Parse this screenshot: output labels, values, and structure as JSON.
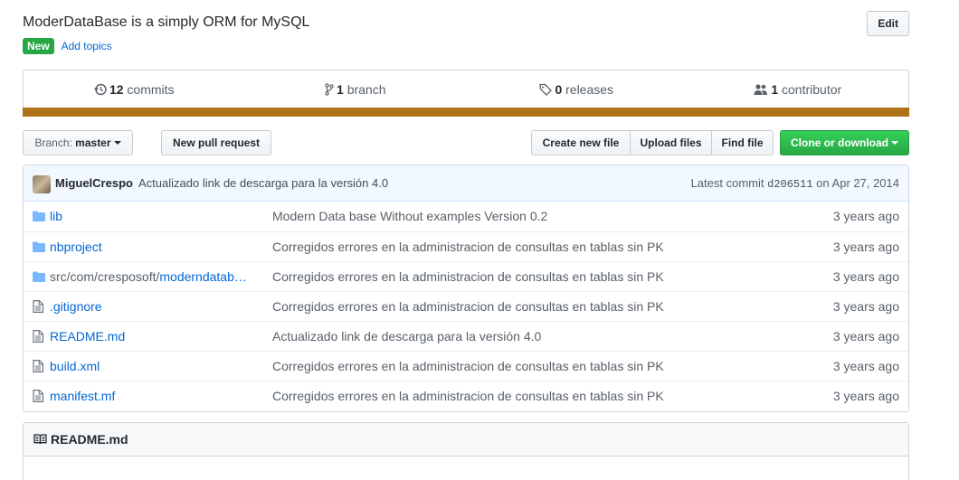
{
  "repo": {
    "description": "ModerDataBase is a simply ORM for MySQL",
    "edit_label": "Edit",
    "new_badge": "New",
    "add_topics": "Add topics"
  },
  "summary": {
    "commits_count": "12",
    "commits_label": "commits",
    "branches_count": "1",
    "branches_label": "branch",
    "releases_count": "0",
    "releases_label": "releases",
    "contributors_count": "1",
    "contributors_label": "contributor",
    "language_color": "#b07219"
  },
  "toolbar": {
    "branch_prefix": "Branch:",
    "branch_name": "master",
    "new_pull_request": "New pull request",
    "create_new_file": "Create new file",
    "upload_files": "Upload files",
    "find_file": "Find file",
    "clone_or_download": "Clone or download"
  },
  "commit": {
    "author": "MiguelCrespo",
    "message": "Actualizado link de descarga para la versión 4.0",
    "latest_label": "Latest commit",
    "sha": "d206511",
    "date_prefix": "on",
    "date": "Apr 27, 2014"
  },
  "files": [
    {
      "type": "dir",
      "icon": "folder-icon",
      "name": "lib",
      "message": "Modern Data base Without examples Version 0.2",
      "age": "3 years ago"
    },
    {
      "type": "dir",
      "icon": "folder-icon",
      "name": "nbproject",
      "message": "Corregidos errores en la administracion de consultas en tablas sin PK",
      "age": "3 years ago"
    },
    {
      "type": "dir",
      "icon": "folder-icon",
      "name_prefix": "src/com/cresposoft/",
      "name": "moderndatab…",
      "message": "Corregidos errores en la administracion de consultas en tablas sin PK",
      "age": "3 years ago"
    },
    {
      "type": "file",
      "icon": "file-icon",
      "name": ".gitignore",
      "message": "Corregidos errores en la administracion de consultas en tablas sin PK",
      "age": "3 years ago"
    },
    {
      "type": "file",
      "icon": "file-icon",
      "name": "README.md",
      "message": "Actualizado link de descarga para la versión 4.0",
      "age": "3 years ago"
    },
    {
      "type": "file",
      "icon": "file-icon",
      "name": "build.xml",
      "message": "Corregidos errores en la administracion de consultas en tablas sin PK",
      "age": "3 years ago"
    },
    {
      "type": "file",
      "icon": "file-icon",
      "name": "manifest.mf",
      "message": "Corregidos errores en la administracion de consultas en tablas sin PK",
      "age": "3 years ago"
    }
  ],
  "readme": {
    "title": "README.md"
  }
}
